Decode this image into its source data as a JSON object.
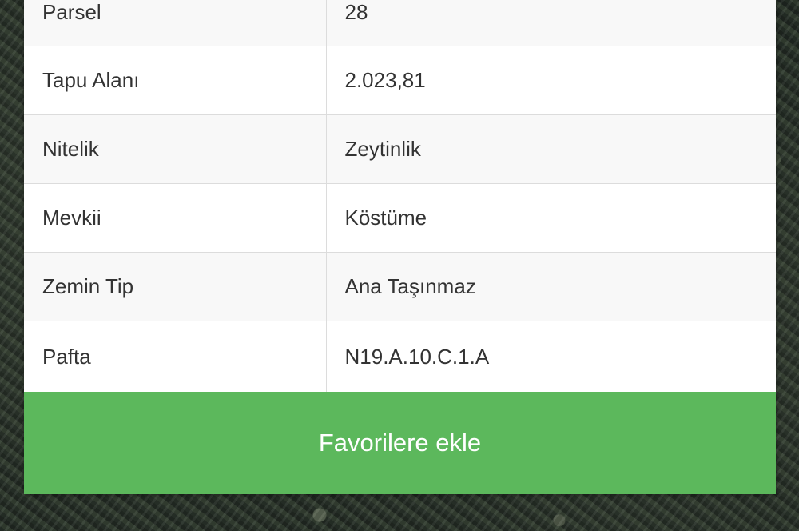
{
  "rows": [
    {
      "label": "Parsel",
      "value": "28"
    },
    {
      "label": "Tapu Alanı",
      "value": "2.023,81"
    },
    {
      "label": "Nitelik",
      "value": "Zeytinlik"
    },
    {
      "label": "Mevkii",
      "value": "Köstüme"
    },
    {
      "label": "Zemin Tip",
      "value": "Ana Taşınmaz"
    },
    {
      "label": "Pafta",
      "value": "N19.A.10.C.1.A"
    }
  ],
  "actions": {
    "favorite_label": "Favorilere ekle"
  },
  "colors": {
    "button_green": "#5cb85c",
    "row_alt": "#f8f8f8",
    "border": "#dcdcdc"
  }
}
